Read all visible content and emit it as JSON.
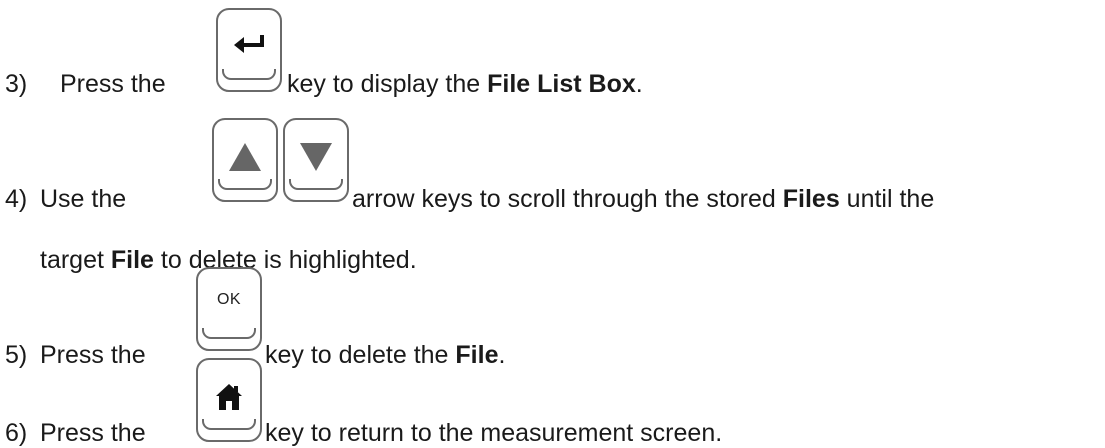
{
  "steps": [
    {
      "number": "3)",
      "before": "Press the",
      "after": "key to display the ",
      "bold": "File List Box",
      "tail": ".",
      "key": "enter-icon"
    },
    {
      "number": "4)",
      "before": "Use the",
      "after_a": "arrow keys to scroll through the stored ",
      "bold_a": "Files",
      "after_b": " until the",
      "line2_a": "target ",
      "line2_bold": "File",
      "line2_b": " to delete is highlighted.",
      "keys": [
        "up-arrow-icon",
        "down-arrow-icon"
      ]
    },
    {
      "number": "5)",
      "before": "Press the",
      "key_label": "OK",
      "after": "key to delete the ",
      "bold": "File",
      "tail": "."
    },
    {
      "number": "6)",
      "before": "Press the",
      "after": "key to return to the measurement screen.",
      "key": "home-icon"
    }
  ]
}
